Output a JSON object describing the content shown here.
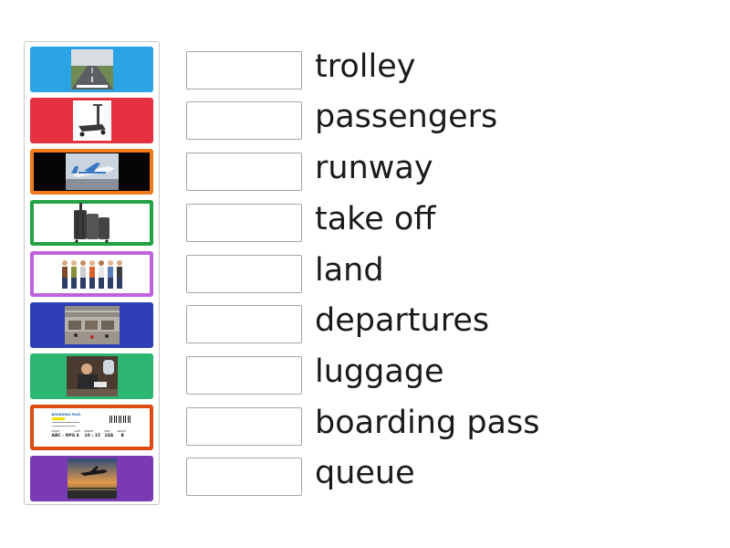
{
  "tiles": [
    {
      "picture": "runway",
      "style": "filled",
      "color": "#2ca3e4"
    },
    {
      "picture": "trolley",
      "style": "filled",
      "color": "#e53140"
    },
    {
      "picture": "take-off",
      "style": "framed",
      "color": "#f07a1c"
    },
    {
      "picture": "luggage",
      "style": "framed",
      "color": "#23a243"
    },
    {
      "picture": "queue",
      "style": "framed",
      "color": "#c062dc"
    },
    {
      "picture": "departures",
      "style": "filled",
      "color": "#2f3fb5"
    },
    {
      "picture": "passengers",
      "style": "filled",
      "color": "#2db672"
    },
    {
      "picture": "boarding-pass",
      "style": "framed",
      "color": "#de4a12"
    },
    {
      "picture": "land",
      "style": "filled",
      "color": "#7a3ab4"
    }
  ],
  "boarding_pass": {
    "heading": "BOARDING PASS",
    "route": "ABC - RPG",
    "gate": "4",
    "time": "10 : 15",
    "seat": "24A",
    "group": "B",
    "labels": {
      "flight": "FLIGHT",
      "gate": "GATE",
      "depart": "DEPART",
      "seat": "SEAT",
      "group": "GROUP"
    }
  },
  "words": [
    "trolley",
    "passengers",
    "runway",
    "take off",
    "land",
    "departures",
    "luggage",
    "boarding pass",
    "queue"
  ]
}
